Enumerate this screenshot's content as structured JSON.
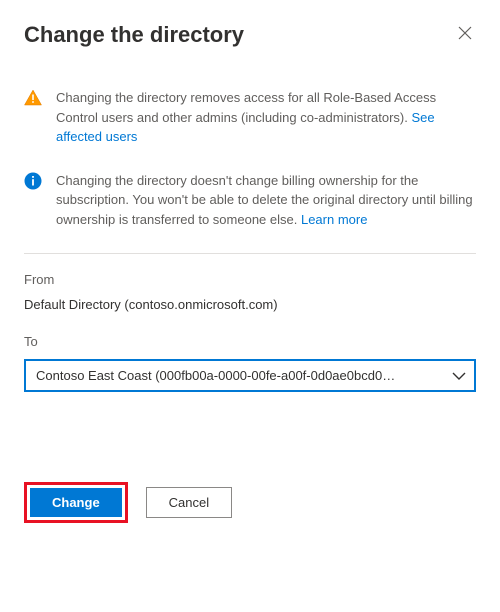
{
  "header": {
    "title": "Change the directory"
  },
  "alerts": {
    "warning_text": "Changing the directory removes access for all Role-Based Access Control users and other admins (including co-administrators). ",
    "warning_link": "See affected users",
    "info_text": "Changing the directory doesn't change billing ownership for the subscription. You won't be able to delete the original directory until billing ownership is transferred to someone else. ",
    "info_link": "Learn more"
  },
  "from": {
    "label": "From",
    "value": "Default Directory (contoso.onmicrosoft.com)"
  },
  "to": {
    "label": "To",
    "selected": "Contoso East Coast (000fb00a-0000-00fe-a00f-0d0ae0bcd0…"
  },
  "buttons": {
    "change": "Change",
    "cancel": "Cancel"
  }
}
